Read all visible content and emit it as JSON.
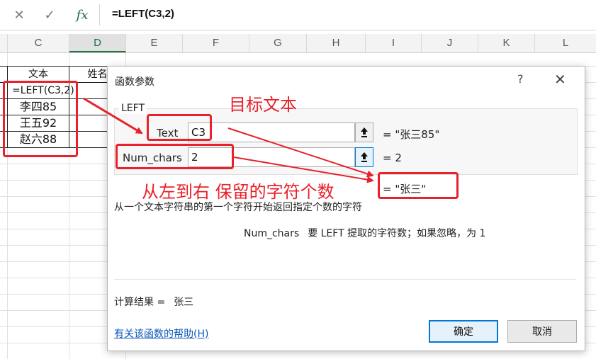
{
  "formula_bar": {
    "cancel_icon": "close-x-icon",
    "confirm_icon": "checkmark-icon",
    "fx_label": "fx",
    "formula": "=LEFT(C3,2)"
  },
  "columns": [
    "C",
    "D",
    "E",
    "F",
    "G",
    "H",
    "I",
    "J",
    "K",
    "L"
  ],
  "selected_column": "D",
  "cells": {
    "c_header": "文本",
    "d_header": "姓名",
    "c3": "=LEFT(C3,2)",
    "c4": "李四85",
    "c5": "王五92",
    "c6": "赵六88"
  },
  "dialog": {
    "title": "函数参数",
    "help": "?",
    "close": "✕",
    "function_name": "LEFT",
    "args": [
      {
        "label": "Text",
        "value": "C3",
        "result": "=   \"张三85\""
      },
      {
        "label": "Num_chars",
        "value": "2",
        "result": "=   2"
      }
    ],
    "formula_result": "=   \"张三\"",
    "description": "从一个文本字符串的第一个字符开始返回指定个数的字符",
    "arg_desc_name": "Num_chars",
    "arg_desc_text": "要 LEFT 提取的字符数；如果忽略，为 1",
    "calc_label": "计算结果 =",
    "calc_value": "张三",
    "help_link": "有关该函数的帮助(H)",
    "ok": "确定",
    "cancel": "取消"
  },
  "annotations": {
    "target_text": "目标文本",
    "keep_left": "从左到右 保留的字符个数"
  },
  "colors": {
    "annotation_red": "#e8212a",
    "excel_green": "#217346",
    "link_blue": "#0b57b8"
  }
}
